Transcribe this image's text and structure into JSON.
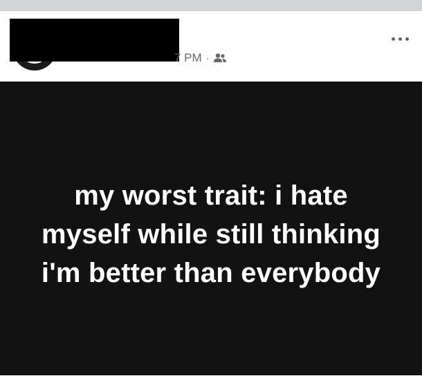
{
  "header": {
    "time_text": "7 PM",
    "separator": "·",
    "audience_icon": "friends-icon",
    "more_icon": "more-options-icon"
  },
  "post": {
    "text": "my worst trait: i hate myself while still thinking i'm better than everybody"
  },
  "colors": {
    "background_post": "#121212",
    "text_post": "#ffffff",
    "meta_text": "#65676b",
    "top_strip": "#d2d4d8",
    "redaction": "#000000"
  }
}
